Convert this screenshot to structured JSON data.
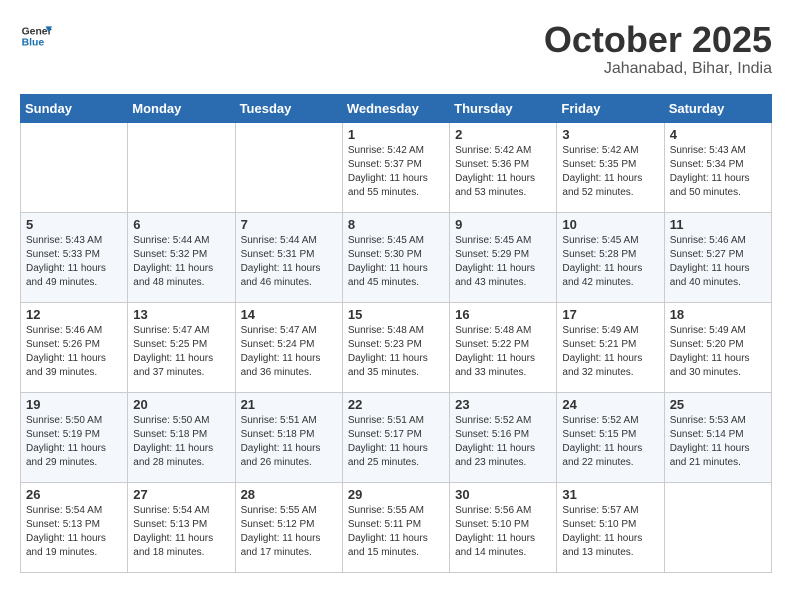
{
  "header": {
    "logo_general": "General",
    "logo_blue": "Blue",
    "month": "October 2025",
    "location": "Jahanabad, Bihar, India"
  },
  "days_of_week": [
    "Sunday",
    "Monday",
    "Tuesday",
    "Wednesday",
    "Thursday",
    "Friday",
    "Saturday"
  ],
  "weeks": [
    [
      {
        "day": "",
        "info": ""
      },
      {
        "day": "",
        "info": ""
      },
      {
        "day": "",
        "info": ""
      },
      {
        "day": "1",
        "info": "Sunrise: 5:42 AM\nSunset: 5:37 PM\nDaylight: 11 hours\nand 55 minutes."
      },
      {
        "day": "2",
        "info": "Sunrise: 5:42 AM\nSunset: 5:36 PM\nDaylight: 11 hours\nand 53 minutes."
      },
      {
        "day": "3",
        "info": "Sunrise: 5:42 AM\nSunset: 5:35 PM\nDaylight: 11 hours\nand 52 minutes."
      },
      {
        "day": "4",
        "info": "Sunrise: 5:43 AM\nSunset: 5:34 PM\nDaylight: 11 hours\nand 50 minutes."
      }
    ],
    [
      {
        "day": "5",
        "info": "Sunrise: 5:43 AM\nSunset: 5:33 PM\nDaylight: 11 hours\nand 49 minutes."
      },
      {
        "day": "6",
        "info": "Sunrise: 5:44 AM\nSunset: 5:32 PM\nDaylight: 11 hours\nand 48 minutes."
      },
      {
        "day": "7",
        "info": "Sunrise: 5:44 AM\nSunset: 5:31 PM\nDaylight: 11 hours\nand 46 minutes."
      },
      {
        "day": "8",
        "info": "Sunrise: 5:45 AM\nSunset: 5:30 PM\nDaylight: 11 hours\nand 45 minutes."
      },
      {
        "day": "9",
        "info": "Sunrise: 5:45 AM\nSunset: 5:29 PM\nDaylight: 11 hours\nand 43 minutes."
      },
      {
        "day": "10",
        "info": "Sunrise: 5:45 AM\nSunset: 5:28 PM\nDaylight: 11 hours\nand 42 minutes."
      },
      {
        "day": "11",
        "info": "Sunrise: 5:46 AM\nSunset: 5:27 PM\nDaylight: 11 hours\nand 40 minutes."
      }
    ],
    [
      {
        "day": "12",
        "info": "Sunrise: 5:46 AM\nSunset: 5:26 PM\nDaylight: 11 hours\nand 39 minutes."
      },
      {
        "day": "13",
        "info": "Sunrise: 5:47 AM\nSunset: 5:25 PM\nDaylight: 11 hours\nand 37 minutes."
      },
      {
        "day": "14",
        "info": "Sunrise: 5:47 AM\nSunset: 5:24 PM\nDaylight: 11 hours\nand 36 minutes."
      },
      {
        "day": "15",
        "info": "Sunrise: 5:48 AM\nSunset: 5:23 PM\nDaylight: 11 hours\nand 35 minutes."
      },
      {
        "day": "16",
        "info": "Sunrise: 5:48 AM\nSunset: 5:22 PM\nDaylight: 11 hours\nand 33 minutes."
      },
      {
        "day": "17",
        "info": "Sunrise: 5:49 AM\nSunset: 5:21 PM\nDaylight: 11 hours\nand 32 minutes."
      },
      {
        "day": "18",
        "info": "Sunrise: 5:49 AM\nSunset: 5:20 PM\nDaylight: 11 hours\nand 30 minutes."
      }
    ],
    [
      {
        "day": "19",
        "info": "Sunrise: 5:50 AM\nSunset: 5:19 PM\nDaylight: 11 hours\nand 29 minutes."
      },
      {
        "day": "20",
        "info": "Sunrise: 5:50 AM\nSunset: 5:18 PM\nDaylight: 11 hours\nand 28 minutes."
      },
      {
        "day": "21",
        "info": "Sunrise: 5:51 AM\nSunset: 5:18 PM\nDaylight: 11 hours\nand 26 minutes."
      },
      {
        "day": "22",
        "info": "Sunrise: 5:51 AM\nSunset: 5:17 PM\nDaylight: 11 hours\nand 25 minutes."
      },
      {
        "day": "23",
        "info": "Sunrise: 5:52 AM\nSunset: 5:16 PM\nDaylight: 11 hours\nand 23 minutes."
      },
      {
        "day": "24",
        "info": "Sunrise: 5:52 AM\nSunset: 5:15 PM\nDaylight: 11 hours\nand 22 minutes."
      },
      {
        "day": "25",
        "info": "Sunrise: 5:53 AM\nSunset: 5:14 PM\nDaylight: 11 hours\nand 21 minutes."
      }
    ],
    [
      {
        "day": "26",
        "info": "Sunrise: 5:54 AM\nSunset: 5:13 PM\nDaylight: 11 hours\nand 19 minutes."
      },
      {
        "day": "27",
        "info": "Sunrise: 5:54 AM\nSunset: 5:13 PM\nDaylight: 11 hours\nand 18 minutes."
      },
      {
        "day": "28",
        "info": "Sunrise: 5:55 AM\nSunset: 5:12 PM\nDaylight: 11 hours\nand 17 minutes."
      },
      {
        "day": "29",
        "info": "Sunrise: 5:55 AM\nSunset: 5:11 PM\nDaylight: 11 hours\nand 15 minutes."
      },
      {
        "day": "30",
        "info": "Sunrise: 5:56 AM\nSunset: 5:10 PM\nDaylight: 11 hours\nand 14 minutes."
      },
      {
        "day": "31",
        "info": "Sunrise: 5:57 AM\nSunset: 5:10 PM\nDaylight: 11 hours\nand 13 minutes."
      },
      {
        "day": "",
        "info": ""
      }
    ]
  ]
}
